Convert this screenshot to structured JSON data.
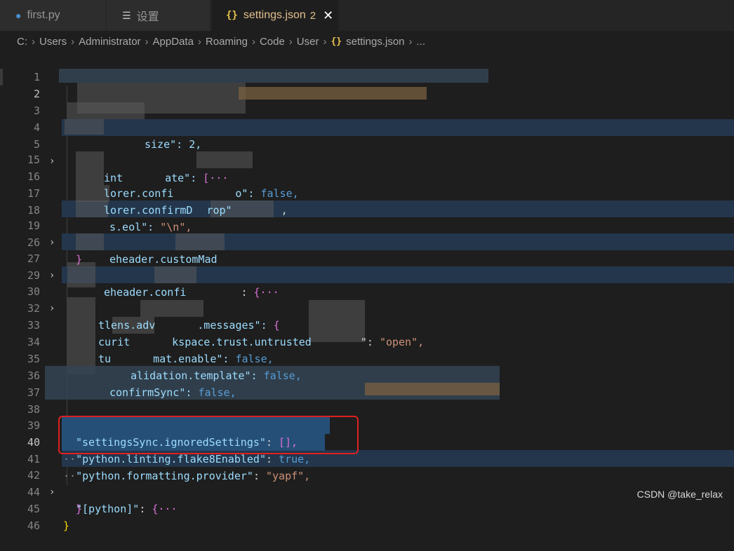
{
  "tabs": [
    {
      "label": "first.py",
      "icon": "python-icon"
    },
    {
      "label": "设置",
      "icon": "menu-icon"
    },
    {
      "label": "settings.json",
      "icon": "braces-icon",
      "problems": "2",
      "close": "✕"
    }
  ],
  "breadcrumb": [
    "C:",
    "Users",
    "Administrator",
    "AppData",
    "Roaming",
    "Code",
    "User",
    "settings.json",
    "..."
  ],
  "lines": [
    {
      "n": "1"
    },
    {
      "n": "2"
    },
    {
      "n": "3"
    },
    {
      "n": "4"
    },
    {
      "n": "5"
    },
    {
      "n": "15"
    },
    {
      "n": "16"
    },
    {
      "n": "17"
    },
    {
      "n": "18"
    },
    {
      "n": "19"
    },
    {
      "n": "26"
    },
    {
      "n": "27"
    },
    {
      "n": "29"
    },
    {
      "n": "30"
    },
    {
      "n": "32"
    },
    {
      "n": "33"
    },
    {
      "n": "34"
    },
    {
      "n": "35"
    },
    {
      "n": "36"
    },
    {
      "n": "37"
    },
    {
      "n": "38"
    },
    {
      "n": "39"
    },
    {
      "n": "40"
    },
    {
      "n": "41"
    },
    {
      "n": "42"
    },
    {
      "n": "44"
    },
    {
      "n": "45"
    },
    {
      "n": "46"
    }
  ],
  "code": {
    "l4": "size\": 2,",
    "l5_key": "int",
    "l5_rest": "ate\": ",
    "l5_val": "[···",
    "l16_key": "lorer.confi",
    "l16_mid": "o\": ",
    "l16_val": "false,",
    "l17_key": "lorer.confirmD",
    "l17_rest": "rop\"",
    "l17_tail": ",",
    "l18_key": "s.eol\": ",
    "l18_val": "\"\\n\",",
    "l19_key": "eheader.customMad",
    "l26": "}",
    "l27_key": "eheader.confi",
    "l27_rest": "  : ",
    "l27_val": "{···",
    "l30_key": "tlens.adv",
    "l30_rest": ".messages\": ",
    "l30_val": "{",
    "l33_key": "curit",
    "l33_mid": "kspace.trust.untrusted",
    "l33_rest": "\": ",
    "l33_val": "\"open\",",
    "l34_key": "tu",
    "l34_mid": "mat.enable\": ",
    "l34_val": "false,",
    "l35_key": "alidation.template\": ",
    "l35_val": "false,",
    "l36_key": "confirmSync\": ",
    "l36_val": "false,",
    "l39_key": "\"settingsSync.ignoredSettings\"",
    "l39_rest": ": ",
    "l39_val": "[],",
    "l40_key": "\"python.linting.flake8Enabled\"",
    "l40_rest": ": ",
    "l40_val": "true,",
    "l41_key": "\"python.formatting.provider\"",
    "l41_rest": ": ",
    "l41_val": "\"yapf\",",
    "l42_key": "\"[python]\"",
    "l42_rest": ": ",
    "l42_val": "{···",
    "l44": "}",
    "l45": "}",
    "dots40": "··",
    "dots41": "··"
  },
  "watermark": "CSDN @take_relax",
  "colors": {
    "key": "#9cdcfe",
    "string": "#ce9178",
    "bool": "#569cd6",
    "highlight": "#264f78",
    "annotation_box": "#e02020"
  }
}
